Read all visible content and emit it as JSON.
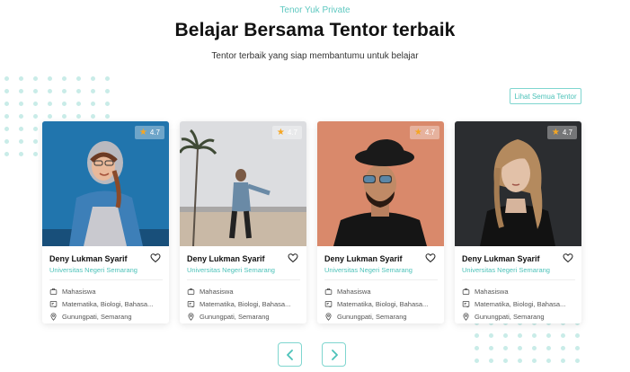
{
  "header": {
    "eyebrow": "Tenor Yuk Private",
    "title": "Belajar Bersama Tentor terbaik",
    "subtitle": "Tentor terbaik yang siap membantumu untuk belajar"
  },
  "see_all_label": "Lihat Semua Tentor",
  "tutors": [
    {
      "rating": "4.7",
      "name": "Deny Lukman Syarif",
      "university": "Universitas Negeri Semarang",
      "role": "Mahasiswa",
      "subjects": "Matematika, Biologi, Bahasa...",
      "location": "Gunungpati, Semarang"
    },
    {
      "rating": "4.7",
      "name": "Deny Lukman Syarif",
      "university": "Universitas Negeri Semarang",
      "role": "Mahasiswa",
      "subjects": "Matematika, Biologi, Bahasa...",
      "location": "Gunungpati, Semarang"
    },
    {
      "rating": "4.7",
      "name": "Deny Lukman Syarif",
      "university": "Universitas Negeri Semarang",
      "role": "Mahasiswa",
      "subjects": "Matematika, Biologi, Bahasa...",
      "location": "Gunungpati, Semarang"
    },
    {
      "rating": "4.7",
      "name": "Deny Lukman Syarif",
      "university": "Universitas Negeri Semarang",
      "role": "Mahasiswa",
      "subjects": "Matematika, Biologi, Bahasa...",
      "location": "Gunungpati, Semarang"
    }
  ],
  "icons": {
    "star": "star-icon",
    "heart": "heart-icon",
    "role": "briefcase-icon",
    "subjects": "book-icon",
    "location": "map-pin-icon",
    "prev": "chevron-left-icon",
    "next": "chevron-right-icon"
  },
  "colors": {
    "accent": "#4cc2b9",
    "accent_border": "#7fd6cf",
    "dots": "#c9ece8",
    "star": "#f5a623"
  }
}
